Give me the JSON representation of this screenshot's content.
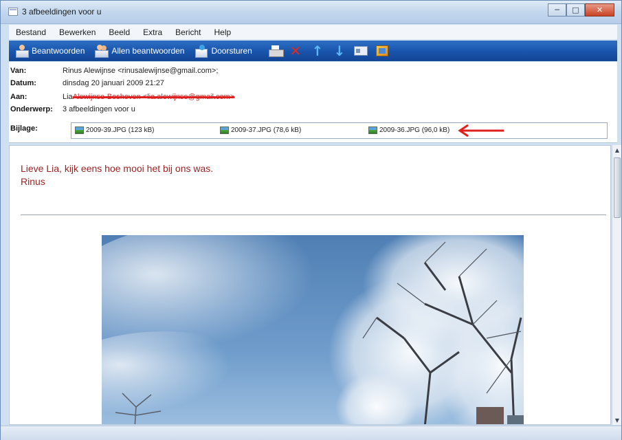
{
  "window": {
    "title": "3 afbeeldingen voor u",
    "controls": {
      "minimize": "─",
      "maximize": "□",
      "close": "✕"
    }
  },
  "menu": {
    "items": [
      "Bestand",
      "Bewerken",
      "Beeld",
      "Extra",
      "Bericht",
      "Help"
    ]
  },
  "toolbar": {
    "reply": "Beantwoorden",
    "reply_all": "Allen beantwoorden",
    "forward": "Doorsturen",
    "icons": [
      "print-icon",
      "delete-icon",
      "previous-icon",
      "next-icon",
      "contacts-icon",
      "address-book-icon"
    ]
  },
  "headers": {
    "from_label": "Van:",
    "from_value": "Rinus Alewijnse <rinusalewijnse@gmail.com>;",
    "date_label": "Datum:",
    "date_value": "dinsdag 20 januari 2009 21:27",
    "to_label": "Aan:",
    "to_name": "Lia",
    "to_redacted": "Alewijnse-Boshoven <lia.alewijnse@gmail.com>",
    "subject_label": "Onderwerp:",
    "subject_value": "3 afbeeldingen voor u",
    "attach_label": "Bijlage:",
    "attachments": [
      "2009-39.JPG (123 kB)",
      "2009-37.JPG (78,6 kB)",
      "2009-36.JPG (96,0 kB)"
    ]
  },
  "message": {
    "line1": "Lieve Lia, kijk eens hoe mooi het bij ons was.",
    "line2": "Rinus"
  },
  "colors": {
    "toolbar": "#1a56ad",
    "greeting": "#9b2222",
    "annotation_arrow": "#e0201c"
  }
}
